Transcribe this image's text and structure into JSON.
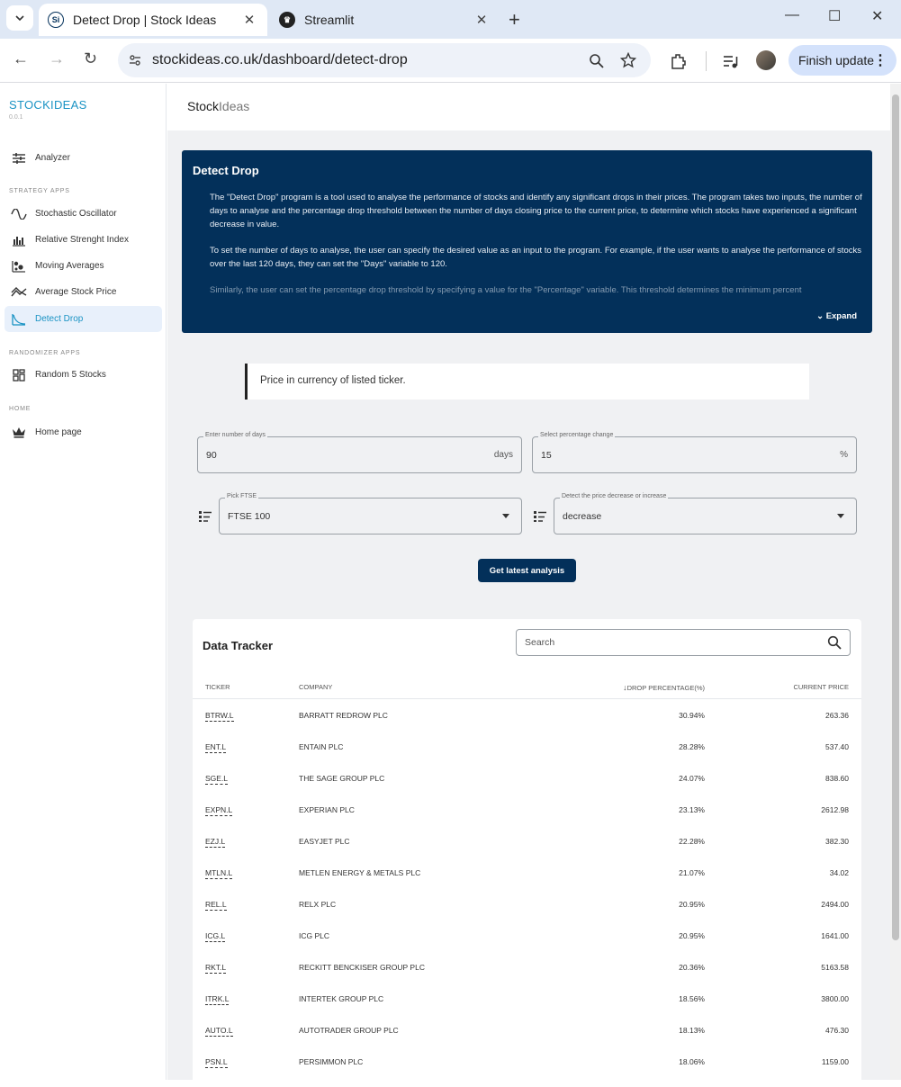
{
  "browser": {
    "tabs": [
      {
        "title": "Detect Drop | Stock Ideas",
        "favicon": "Si"
      },
      {
        "title": "Streamlit"
      }
    ],
    "url": "stockideas.co.uk/dashboard/detect-drop",
    "finish_update": "Finish update"
  },
  "sidebar": {
    "brand": "STOCKIDEAS",
    "version": "0.0.1",
    "items": [
      {
        "label": "Analyzer",
        "icon": "sliders-icon"
      },
      {
        "section": "STRATEGY APPS"
      },
      {
        "label": "Stochastic Oscillator",
        "icon": "wave-icon"
      },
      {
        "label": "Relative Strenght Index",
        "icon": "bar-chart-icon"
      },
      {
        "label": "Moving Averages",
        "icon": "scatter-icon"
      },
      {
        "label": "Average Stock Price",
        "icon": "trend-icon"
      },
      {
        "label": "Detect Drop",
        "icon": "drop-curve-icon",
        "active": true
      },
      {
        "section": "RANDOMIZER APPS"
      },
      {
        "label": "Random 5 Stocks",
        "icon": "grid-icon"
      },
      {
        "section": "HOME"
      },
      {
        "label": "Home page",
        "icon": "crown-icon"
      }
    ]
  },
  "header": {
    "logo_bold": "Stock",
    "logo_light": "Ideas"
  },
  "panel": {
    "title": "Detect Drop",
    "para1": "The \"Detect Drop\" program is a tool used to analyse the performance of stocks and identify any significant drops in their prices. The program takes two inputs, the number of days to analyse and the percentage drop threshold between the number of days closing price to the current price, to determine which stocks have experienced a significant decrease in value.",
    "para2": "To set the number of days to analyse, the user can specify the desired value as an input to the program. For example, if the user wants to analyse the performance of stocks over the last 120 days, they can set the \"Days\" variable to 120.",
    "para3": "Similarly, the user can set the percentage drop threshold by specifying a value for the \"Percentage\" variable. This threshold determines the minimum percent",
    "expand": "Expand"
  },
  "note": "Price in currency of listed ticker.",
  "form": {
    "days_label": "Enter number of days",
    "days_value": "90",
    "days_suffix": "days",
    "pct_label": "Select percentage change",
    "pct_value": "15",
    "pct_suffix": "%",
    "ftse_label": "Pick FTSE",
    "ftse_value": "FTSE 100",
    "dir_label": "Detect the price decrease or increase",
    "dir_value": "decrease",
    "button": "Get latest analysis"
  },
  "tracker": {
    "title": "Data Tracker",
    "search_placeholder": "Search",
    "columns": [
      "TICKER",
      "COMPANY",
      "DROP PERCENTAGE(%)",
      "CURRENT PRICE"
    ],
    "rows": [
      [
        "BTRW.L",
        "BARRATT REDROW PLC",
        "30.94%",
        "263.36"
      ],
      [
        "ENT.L",
        "ENTAIN PLC",
        "28.28%",
        "537.40"
      ],
      [
        "SGE.L",
        "THE SAGE GROUP PLC",
        "24.07%",
        "838.60"
      ],
      [
        "EXPN.L",
        "EXPERIAN PLC",
        "23.13%",
        "2612.98"
      ],
      [
        "EZJ.L",
        "EASYJET PLC",
        "22.28%",
        "382.30"
      ],
      [
        "MTLN.L",
        "METLEN ENERGY & METALS PLC",
        "21.07%",
        "34.02"
      ],
      [
        "REL.L",
        "RELX PLC",
        "20.95%",
        "2494.00"
      ],
      [
        "ICG.L",
        "ICG PLC",
        "20.95%",
        "1641.00"
      ],
      [
        "RKT.L",
        "RECKITT BENCKISER GROUP PLC",
        "20.36%",
        "5163.58"
      ],
      [
        "ITRK.L",
        "INTERTEK GROUP PLC",
        "18.56%",
        "3800.00"
      ],
      [
        "AUTO.L",
        "AUTOTRADER GROUP PLC",
        "18.13%",
        "476.30"
      ],
      [
        "PSN.L",
        "PERSIMMON PLC",
        "18.06%",
        "1159.00"
      ]
    ]
  },
  "colors": {
    "accent": "#1a93c4",
    "navy": "#03305a",
    "bg": "#f0f1f3"
  }
}
